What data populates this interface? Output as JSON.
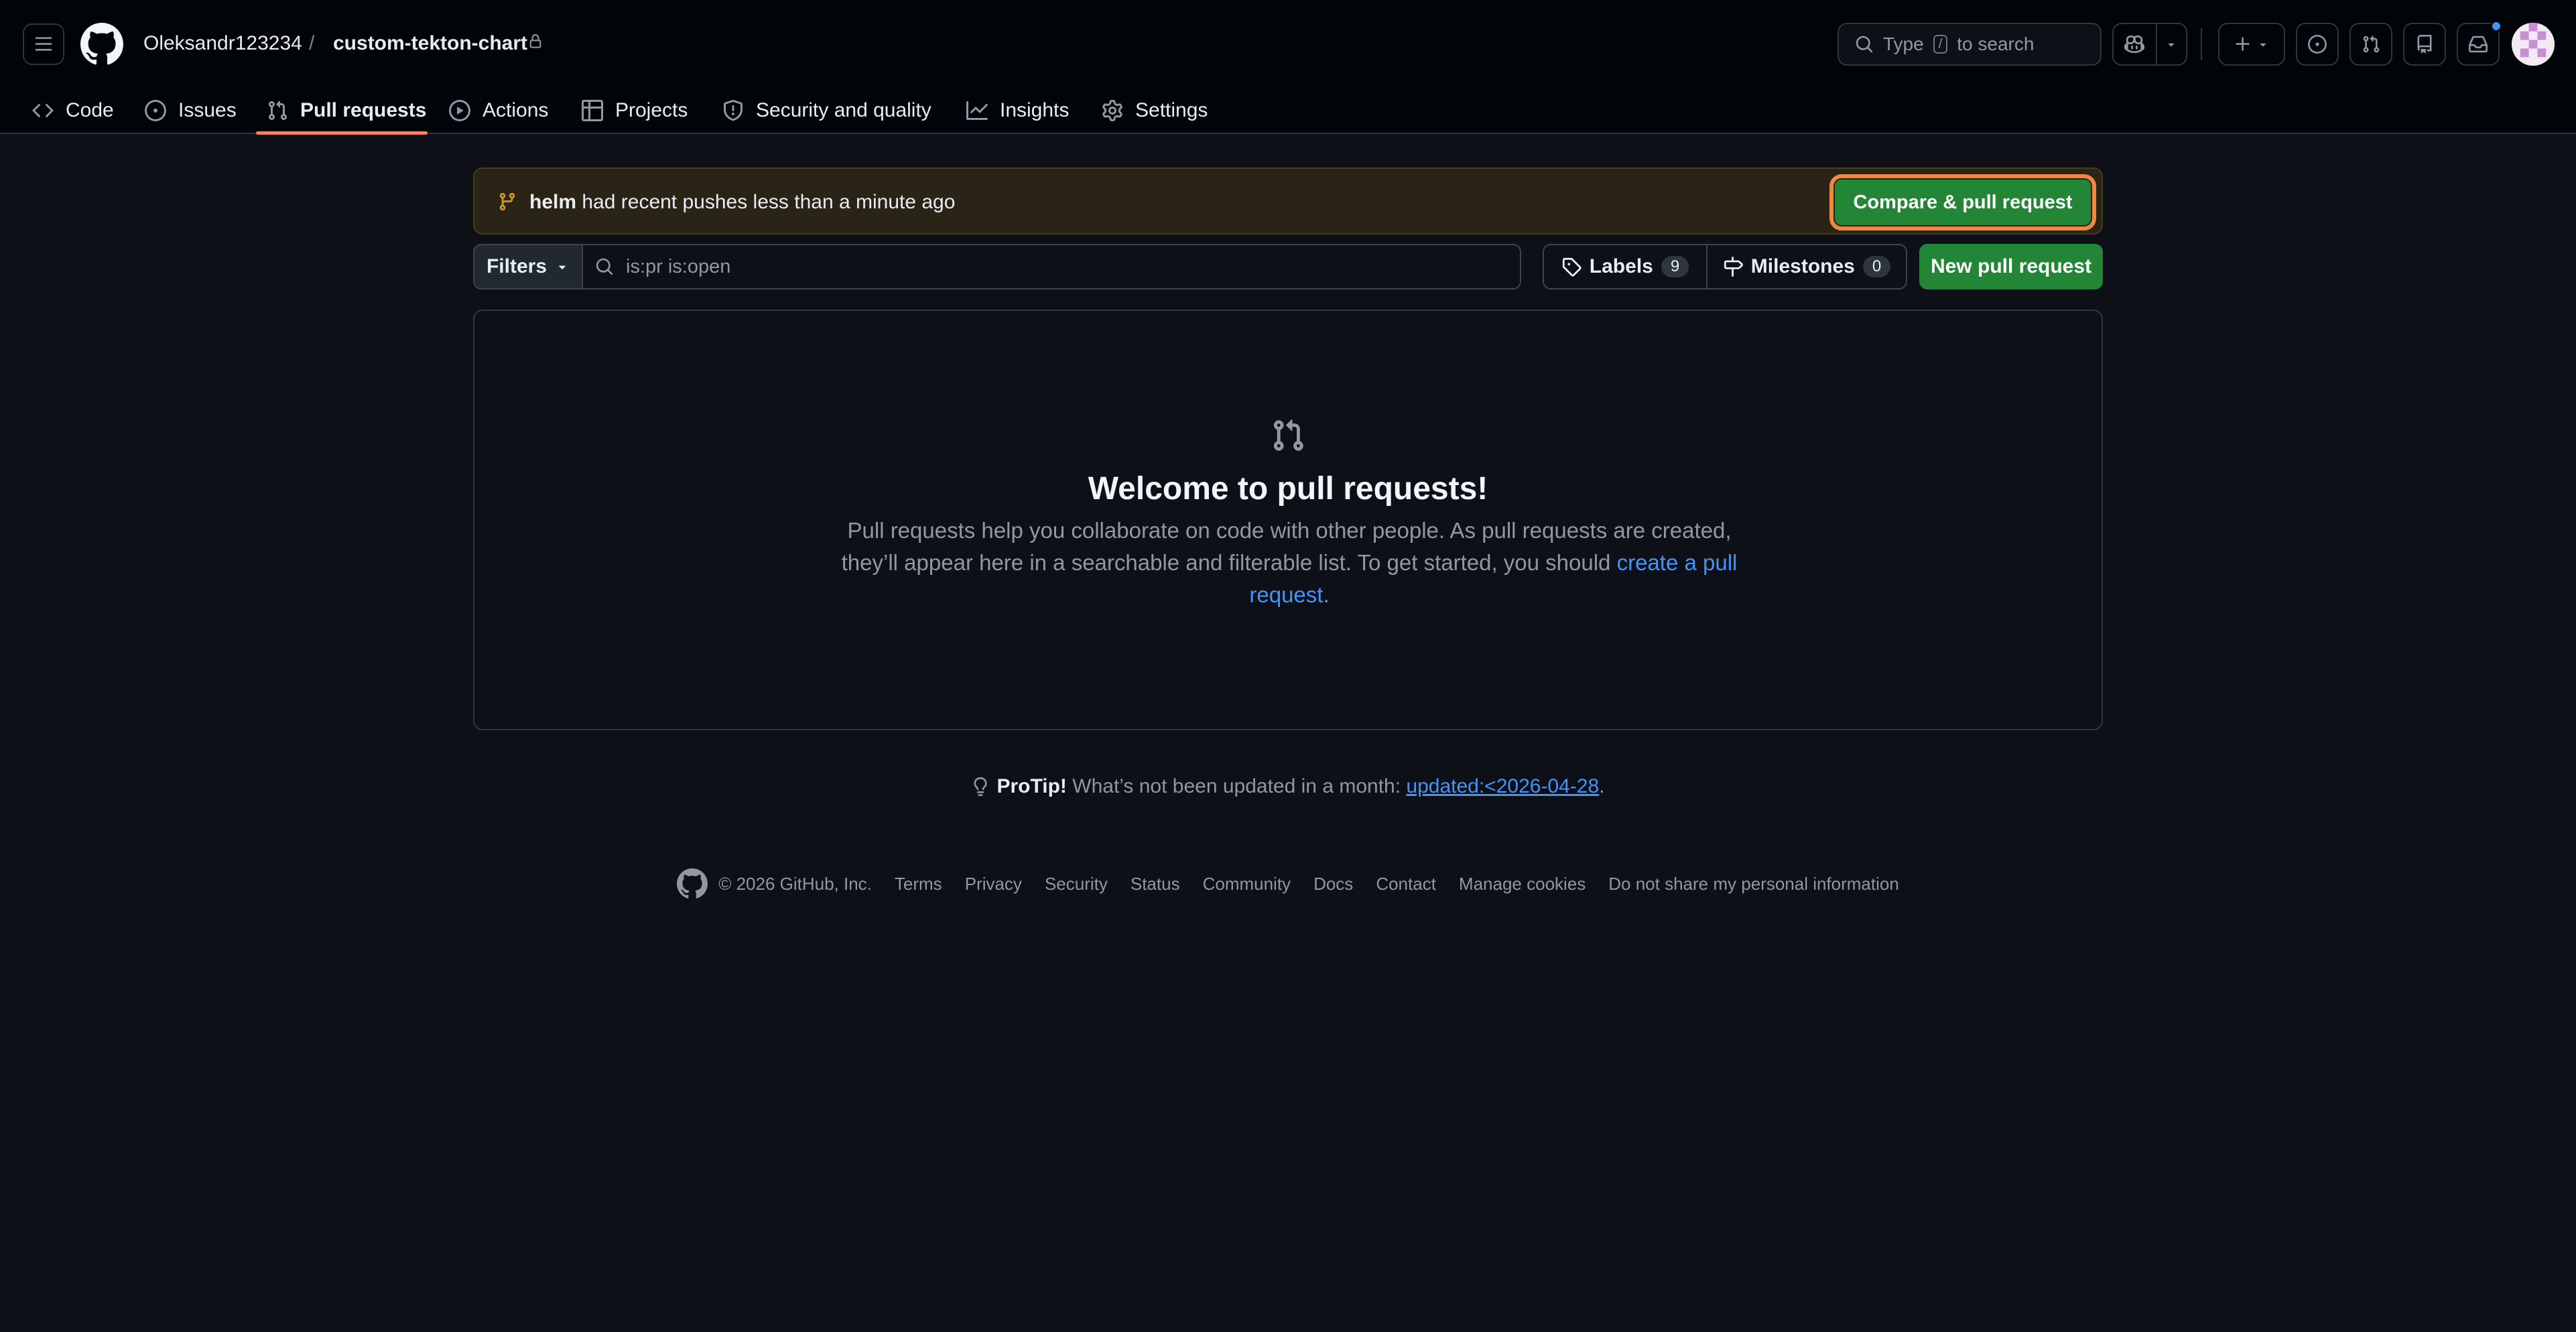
{
  "header": {
    "owner": "Oleksandr123234",
    "separator": "/",
    "repo": "custom-tekton-chart",
    "search_prefix": "Type",
    "search_key": "/",
    "search_suffix": "to search"
  },
  "tabs": [
    {
      "label": "Code",
      "icon": "code-icon"
    },
    {
      "label": "Issues",
      "icon": "issue-opened-icon"
    },
    {
      "label": "Pull requests",
      "icon": "git-pull-request-icon",
      "active": true
    },
    {
      "label": "Actions",
      "icon": "play-icon"
    },
    {
      "label": "Projects",
      "icon": "table-icon"
    },
    {
      "label": "Security and quality",
      "icon": "shield-icon"
    },
    {
      "label": "Insights",
      "icon": "graph-icon"
    },
    {
      "label": "Settings",
      "icon": "gear-icon"
    }
  ],
  "banner": {
    "branch": "helm",
    "message": "had recent pushes less than a minute ago",
    "button": "Compare & pull request"
  },
  "toolbar": {
    "filters": "Filters",
    "search_placeholder": "is:pr is:open",
    "labels": "Labels",
    "labels_count": "9",
    "milestones": "Milestones",
    "milestones_count": "0",
    "new_pr": "New pull request"
  },
  "blankslate": {
    "title": "Welcome to pull requests!",
    "text": "Pull requests help you collaborate on code with other people. As pull requests are created, they’ll appear here in a searchable and filterable list. To get started, you should",
    "link": "create a pull request",
    "end": "."
  },
  "protip": {
    "label": "ProTip!",
    "text": "What’s not been updated in a month:",
    "link": "updated:<2026-04-28",
    "end": "."
  },
  "footer": {
    "copyright": "© 2026 GitHub, Inc.",
    "links": [
      "Terms",
      "Privacy",
      "Security",
      "Status",
      "Community",
      "Docs",
      "Contact",
      "Manage cookies",
      "Do not share my personal information"
    ]
  },
  "colors": {
    "background": "#0d1117",
    "header": "#010409",
    "accent_green": "#238636",
    "link_blue": "#4493f8",
    "tab_underline": "#f78166",
    "highlight_outline": "#f0883e"
  }
}
